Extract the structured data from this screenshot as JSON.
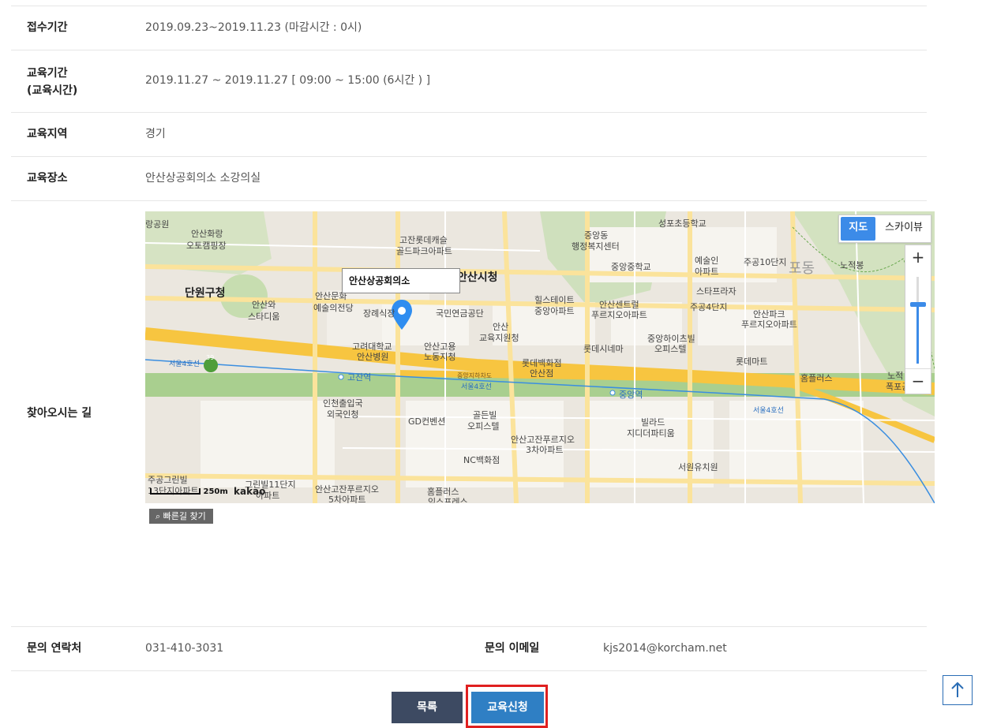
{
  "details": {
    "reception_label": "접수기간",
    "reception_value": "2019.09.23~2019.11.23 (마감시간 : 0시)",
    "period_label_line1": "교육기간",
    "period_label_line2": "(교육시간)",
    "period_value": "2019.11.27 ~ 2019.11.27 [ 09:00 ~ 15:00 (6시간 ) ]",
    "region_label": "교육지역",
    "region_value": "경기",
    "venue_label": "교육장소",
    "venue_value": "안산상공회의소 소강의실",
    "directions_label": "찾아오시는 길",
    "contact_label": "문의 연락처",
    "contact_value": "031-410-3031",
    "email_label": "문의 이메일",
    "email_value": "kjs2014@korcham.net"
  },
  "map": {
    "infowindow_title": "안산상공회의소",
    "type_map": "지도",
    "type_skyview": "스카이뷰",
    "zoom_in": "+",
    "zoom_out": "−",
    "scale_label": "250m",
    "brand": "kakao",
    "find_route": "빠른길 찾기",
    "labels": [
      "랑공원",
      "안산화랑",
      "오토캠핑장",
      "단원구청",
      "안산와",
      "스타디움",
      "안산문화",
      "예술의전당",
      "고잔롯데캐슬",
      "골드파크아파트",
      "안산시청",
      "장례식장",
      "고려대학교",
      "안산병원",
      "국민연금공단",
      "안산고용",
      "노동지청",
      "안산",
      "교육지원청",
      "중앙동",
      "행정복지센터",
      "중앙중학교",
      "힐스테이트",
      "중앙아파트",
      "롯데시네마",
      "롯데백화점",
      "안산점",
      "안산센트럴",
      "푸르지오아파트",
      "성포초등학교",
      "예술인",
      "아파트",
      "주공10단지",
      "스타프라자",
      "주공4단지",
      "중앙하이츠빌",
      "오피스텔",
      "안산파크",
      "푸르지오아파트",
      "롯데마트",
      "홈플러스",
      "노적봉",
      "포동",
      "노적",
      "폭포공",
      "고잔역",
      "중앙역",
      "서울4호선",
      "서울4호선",
      "서울4호선",
      "중앙지하차도",
      "39",
      "인천출입국",
      "외국인청",
      "GD컨벤션",
      "골든빌",
      "오피스텔",
      "안산고잔푸르지오",
      "3차아파트",
      "NC백화점",
      "빌라드",
      "지디더파티움",
      "서원유치원",
      "주공그린빌",
      "13단지아파트",
      "그린빌11단지",
      "아파트",
      "안산고잔푸르지오",
      "5차아파트",
      "홈플러스",
      "익스프레스"
    ]
  },
  "buttons": {
    "list": "목록",
    "apply": "교육신청"
  },
  "colors": {
    "apply_button": "#2f7fc4",
    "list_button": "#3d4a62",
    "highlight_border": "#e02020"
  }
}
